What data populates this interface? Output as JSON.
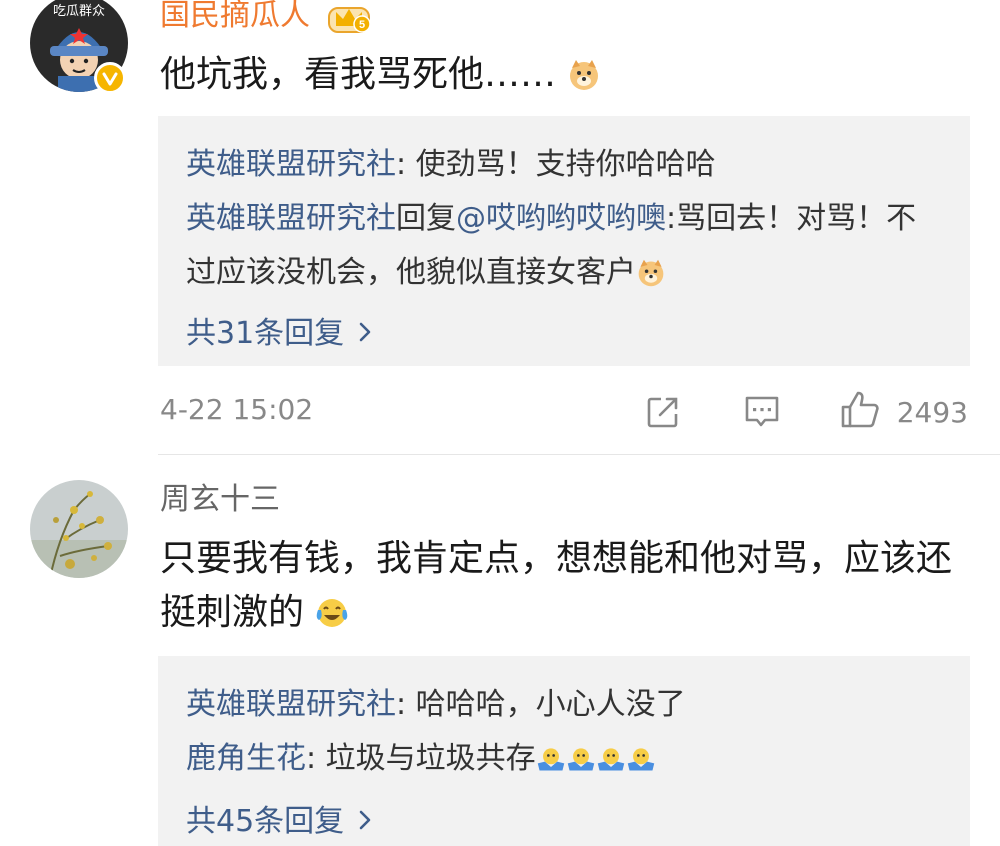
{
  "comments": [
    {
      "username": "国民摘瓜人",
      "avatar_text": "吃瓜群众",
      "text": "他坑我，看我骂死他……",
      "replies": [
        {
          "user": "英雄联盟研究社",
          "sep": ": ",
          "text": "使劲骂！支持你哈哈哈"
        },
        {
          "user": "英雄联盟研究社",
          "reply_word": "回复",
          "mention": "@哎哟哟哎哟噢",
          "sep": ":",
          "text": "骂回去！对骂！不过应该没机会，他貌似直接女客户"
        }
      ],
      "more_label": "共31条回复",
      "time": "4-22 15:02",
      "likes": "2493"
    },
    {
      "username": "周玄十三",
      "text": "只要我有钱，我肯定点，想想能和他对骂，应该还挺刺激的",
      "replies": [
        {
          "user": "英雄联盟研究社",
          "sep": ": ",
          "text": "哈哈哈，小心人没了"
        },
        {
          "user": "鹿角生花",
          "sep": ": ",
          "text": "垃圾与垃圾共存"
        }
      ],
      "more_label": "共45条回复"
    }
  ],
  "icons": [
    "crown-badge-icon",
    "verified-icon",
    "doge-emoji-icon",
    "laugh-cry-emoji-icon",
    "shrug-emoji-icon",
    "chevron-right-icon",
    "share-icon",
    "comment-icon",
    "like-icon"
  ],
  "colors": {
    "username_orange": "#ef7a30",
    "link_blue": "#3f5d8a",
    "reply_bg": "#f2f2f2",
    "meta_gray": "#888888"
  }
}
